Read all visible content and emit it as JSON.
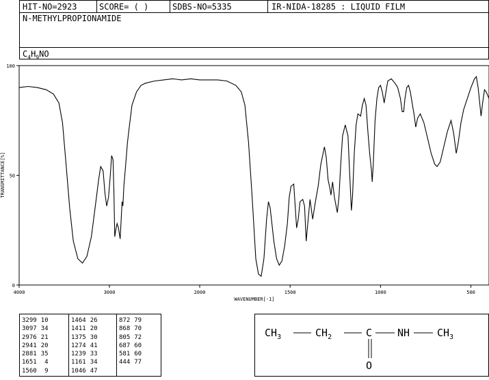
{
  "header": {
    "hit_no": "HIT-NO=2923",
    "score": "SCORE=  (   )",
    "sdbs_no": "SDBS-NO=5335",
    "ir_id": "IR-NIDA-18285 : LIQUID FILM",
    "compound_name": "N-METHYLPROPIONAMIDE",
    "formula_main": "C",
    "formula_sub1": "4",
    "formula_mid": "H",
    "formula_sub2": "9",
    "formula_end": "NO"
  },
  "chart_data": {
    "type": "line",
    "xlabel": "WAVENUMBER[-1]",
    "ylabel": "TRANSMITTANCE[%]",
    "xlim": [
      4000,
      400
    ],
    "ylim": [
      0,
      100
    ],
    "x_ticks": [
      "4000",
      "3000",
      "2000",
      "1500",
      "1000",
      "500"
    ],
    "y_ticks": [
      "100",
      "50",
      "0"
    ],
    "series": [
      {
        "points": [
          [
            4000,
            90
          ],
          [
            3900,
            90.5
          ],
          [
            3800,
            90
          ],
          [
            3700,
            89
          ],
          [
            3620,
            87
          ],
          [
            3560,
            83
          ],
          [
            3520,
            74
          ],
          [
            3480,
            55
          ],
          [
            3440,
            35
          ],
          [
            3400,
            20
          ],
          [
            3350,
            12
          ],
          [
            3299,
            10
          ],
          [
            3250,
            13
          ],
          [
            3200,
            22
          ],
          [
            3150,
            38
          ],
          [
            3120,
            48
          ],
          [
            3097,
            54
          ],
          [
            3070,
            52
          ],
          [
            3050,
            42
          ],
          [
            3030,
            36
          ],
          [
            3010,
            40
          ],
          [
            2990,
            50
          ],
          [
            2976,
            59
          ],
          [
            2960,
            57
          ],
          [
            2950,
            42
          ],
          [
            2941,
            22
          ],
          [
            2930,
            25
          ],
          [
            2915,
            28
          ],
          [
            2900,
            26
          ],
          [
            2881,
            21
          ],
          [
            2870,
            30
          ],
          [
            2860,
            38
          ],
          [
            2851,
            36
          ],
          [
            2840,
            45
          ],
          [
            2820,
            55
          ],
          [
            2800,
            65
          ],
          [
            2780,
            72
          ],
          [
            2750,
            82
          ],
          [
            2700,
            88
          ],
          [
            2650,
            91
          ],
          [
            2600,
            92
          ],
          [
            2500,
            93
          ],
          [
            2400,
            93.5
          ],
          [
            2300,
            94
          ],
          [
            2200,
            93.5
          ],
          [
            2100,
            94
          ],
          [
            2000,
            93.5
          ],
          [
            1900,
            93.5
          ],
          [
            1850,
            93
          ],
          [
            1800,
            91
          ],
          [
            1770,
            88
          ],
          [
            1750,
            82
          ],
          [
            1730,
            65
          ],
          [
            1710,
            40
          ],
          [
            1690,
            12
          ],
          [
            1675,
            5
          ],
          [
            1660,
            4
          ],
          [
            1645,
            12
          ],
          [
            1630,
            30
          ],
          [
            1620,
            38
          ],
          [
            1610,
            35
          ],
          [
            1590,
            20
          ],
          [
            1575,
            12
          ],
          [
            1560,
            9
          ],
          [
            1545,
            11
          ],
          [
            1530,
            18
          ],
          [
            1515,
            28
          ],
          [
            1505,
            40
          ],
          [
            1495,
            45
          ],
          [
            1480,
            46
          ],
          [
            1464,
            26
          ],
          [
            1455,
            30
          ],
          [
            1445,
            38
          ],
          [
            1430,
            39
          ],
          [
            1420,
            36
          ],
          [
            1411,
            20
          ],
          [
            1400,
            30
          ],
          [
            1390,
            39
          ],
          [
            1375,
            30
          ],
          [
            1360,
            38
          ],
          [
            1345,
            45
          ],
          [
            1330,
            55
          ],
          [
            1310,
            63
          ],
          [
            1300,
            58
          ],
          [
            1290,
            48
          ],
          [
            1280,
            44
          ],
          [
            1274,
            41
          ],
          [
            1265,
            47
          ],
          [
            1255,
            40
          ],
          [
            1239,
            33
          ],
          [
            1230,
            40
          ],
          [
            1220,
            55
          ],
          [
            1210,
            68
          ],
          [
            1195,
            73
          ],
          [
            1180,
            68
          ],
          [
            1170,
            50
          ],
          [
            1161,
            34
          ],
          [
            1155,
            40
          ],
          [
            1145,
            60
          ],
          [
            1135,
            73
          ],
          [
            1125,
            78
          ],
          [
            1110,
            77
          ],
          [
            1100,
            82
          ],
          [
            1090,
            85
          ],
          [
            1080,
            82
          ],
          [
            1070,
            70
          ],
          [
            1060,
            60
          ],
          [
            1050,
            52
          ],
          [
            1046,
            47
          ],
          [
            1040,
            55
          ],
          [
            1030,
            75
          ],
          [
            1020,
            85
          ],
          [
            1010,
            90
          ],
          [
            1000,
            91
          ],
          [
            990,
            88
          ],
          [
            980,
            83
          ],
          [
            970,
            88
          ],
          [
            960,
            93
          ],
          [
            940,
            94
          ],
          [
            920,
            92
          ],
          [
            905,
            90
          ],
          [
            890,
            85
          ],
          [
            880,
            79
          ],
          [
            872,
            79
          ],
          [
            865,
            85
          ],
          [
            855,
            90
          ],
          [
            845,
            91
          ],
          [
            835,
            88
          ],
          [
            825,
            83
          ],
          [
            815,
            78
          ],
          [
            805,
            72
          ],
          [
            795,
            76
          ],
          [
            780,
            78
          ],
          [
            760,
            74
          ],
          [
            740,
            67
          ],
          [
            720,
            60
          ],
          [
            700,
            55
          ],
          [
            687,
            54
          ],
          [
            670,
            56
          ],
          [
            650,
            63
          ],
          [
            630,
            70
          ],
          [
            610,
            75
          ],
          [
            595,
            69
          ],
          [
            581,
            60
          ],
          [
            570,
            65
          ],
          [
            555,
            74
          ],
          [
            540,
            80
          ],
          [
            520,
            85
          ],
          [
            500,
            90
          ],
          [
            480,
            94
          ],
          [
            470,
            95
          ],
          [
            460,
            90
          ],
          [
            444,
            77
          ],
          [
            435,
            83
          ],
          [
            425,
            89
          ],
          [
            415,
            88
          ],
          [
            400,
            85
          ]
        ]
      }
    ]
  },
  "peak_table": {
    "columns": [
      [
        [
          "3299",
          "10"
        ],
        [
          "3097",
          "34"
        ],
        [
          "2976",
          "21"
        ],
        [
          "2941",
          "20"
        ],
        [
          "2881",
          "35"
        ],
        [
          "1651",
          "4"
        ],
        [
          "1560",
          "9"
        ]
      ],
      [
        [
          "1464",
          "26"
        ],
        [
          "1411",
          "20"
        ],
        [
          "1375",
          "30"
        ],
        [
          "1274",
          "41"
        ],
        [
          "1239",
          "33"
        ],
        [
          "1161",
          "34"
        ],
        [
          "1046",
          "47"
        ]
      ],
      [
        [
          "872",
          "79"
        ],
        [
          "868",
          "70"
        ],
        [
          "805",
          "72"
        ],
        [
          "687",
          "60"
        ],
        [
          "581",
          "60"
        ],
        [
          "444",
          "77"
        ]
      ]
    ]
  },
  "structure": {
    "ch3_left": "CH",
    "sub3_left": "3",
    "ch2": "CH",
    "sub2": "2",
    "c": "C",
    "nh": "NH",
    "ch3_right": "CH",
    "sub3_right": "3",
    "o": "O"
  }
}
